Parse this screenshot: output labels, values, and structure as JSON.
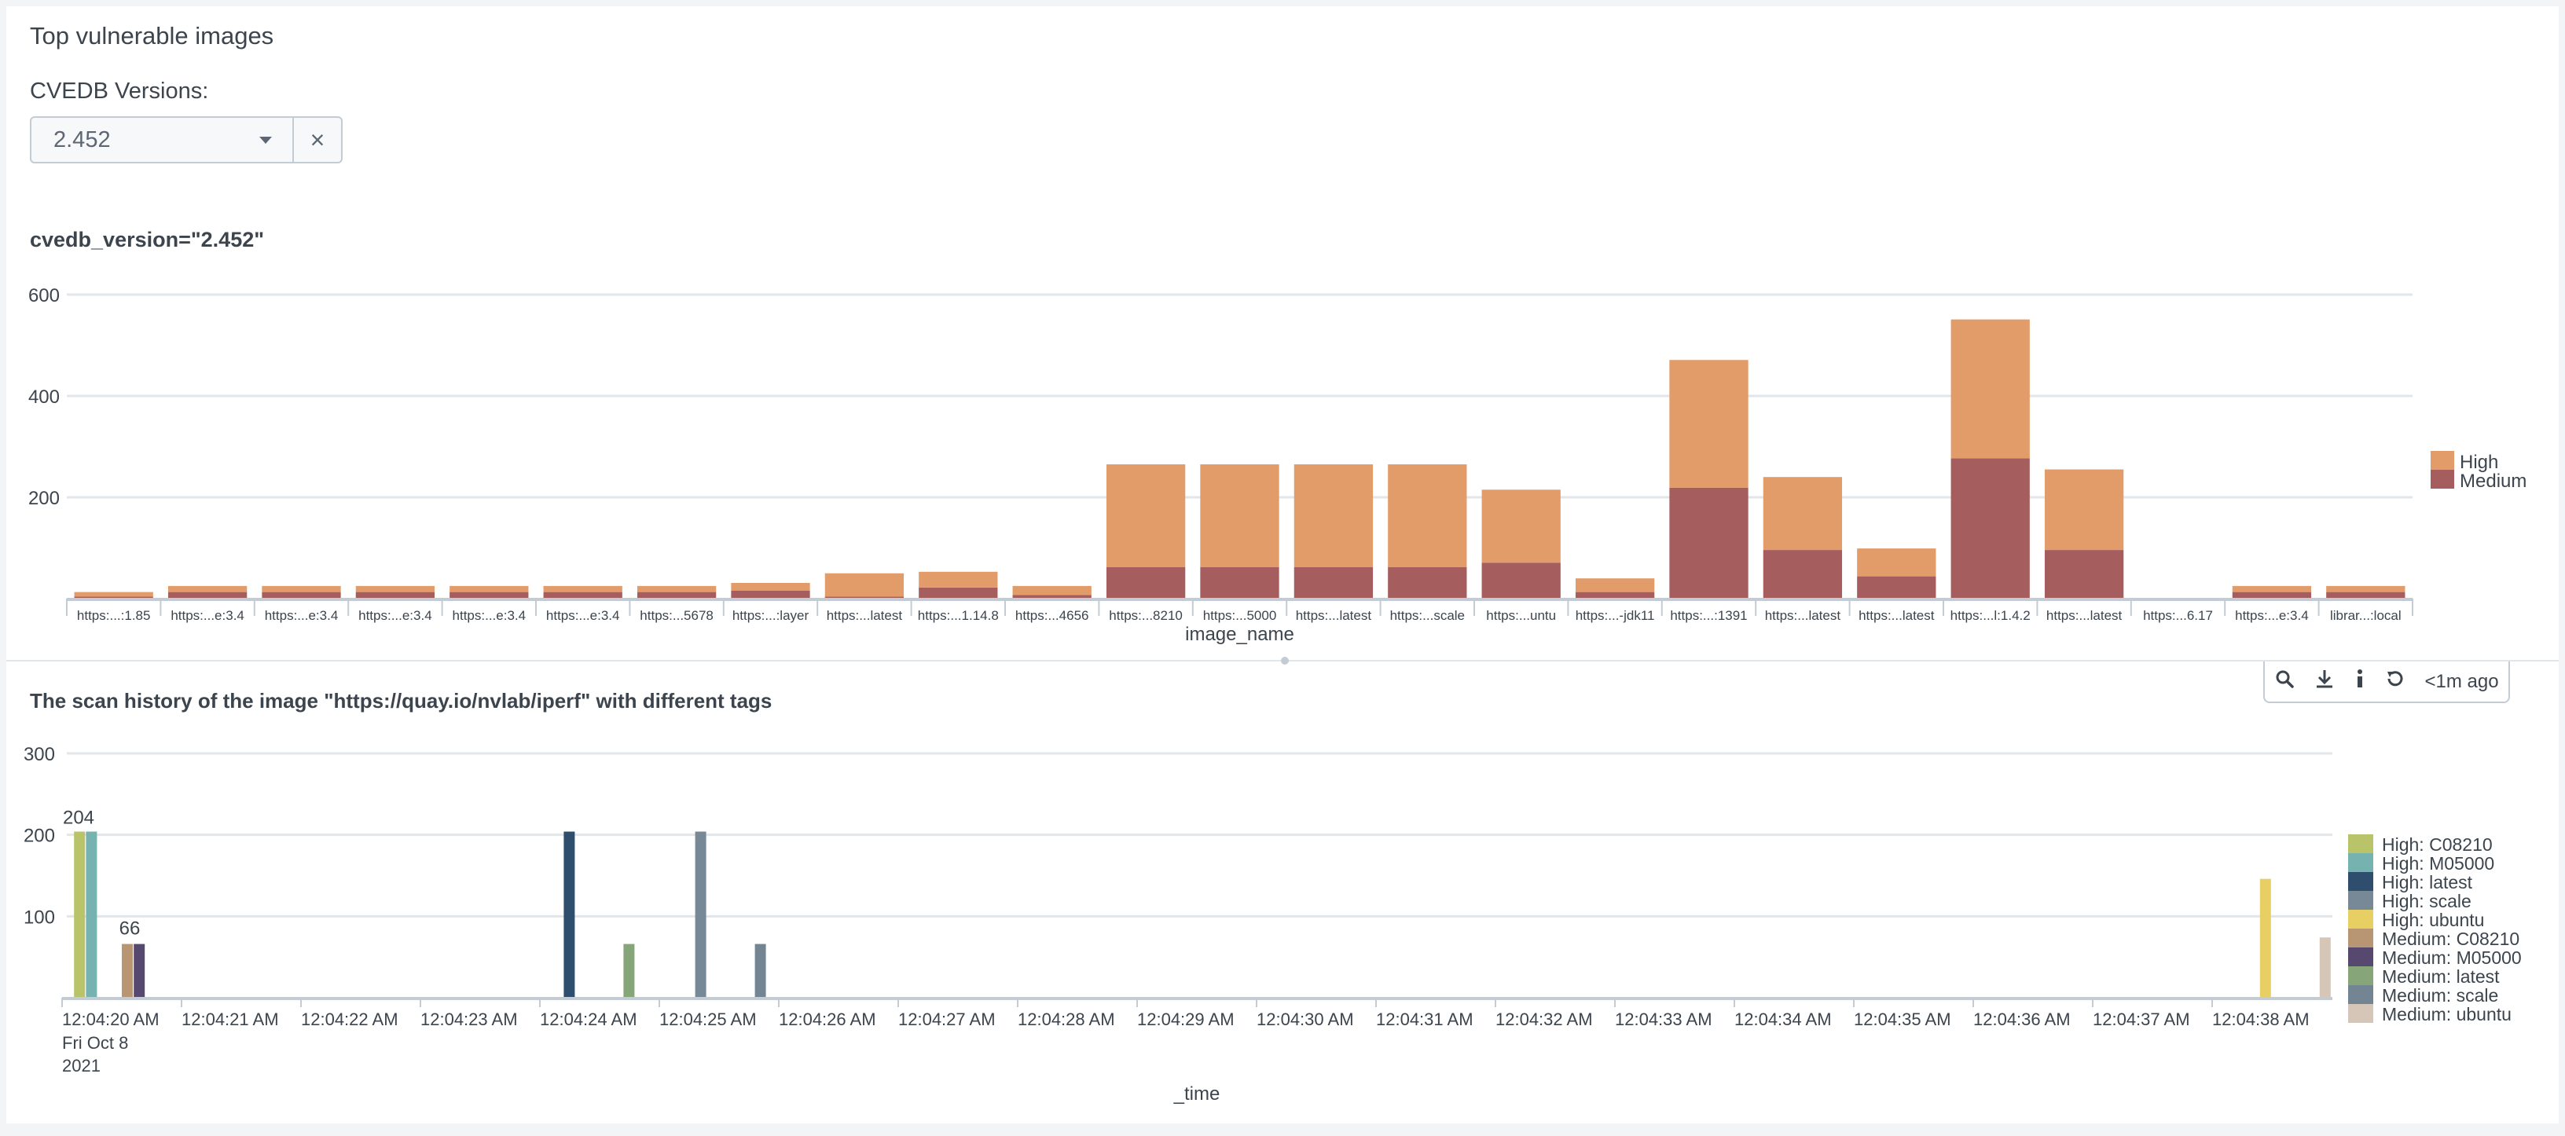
{
  "panel": {
    "title": "Top vulnerable images",
    "filter_label": "CVEDB Versions:",
    "filter_value": "2.452",
    "clear_icon": "×"
  },
  "chart1_title": "cvedb_version=\"2.452\"",
  "chart2_title": "The scan history of the image \"https://quay.io/nvlab/iperf\" with different tags",
  "toolbar": {
    "search_icon": "search-icon",
    "download_icon": "download-icon",
    "info_icon": "info-icon",
    "refresh_icon": "refresh-icon",
    "updated": "<1m ago"
  },
  "chart_data": [
    {
      "type": "bar",
      "stacked": true,
      "title": "cvedb_version=\"2.452\"",
      "xlabel": "image_name",
      "ylabel": "",
      "ylim": [
        0,
        600
      ],
      "yticks": [
        200,
        400,
        600
      ],
      "grid": true,
      "legend": "right",
      "categories": [
        "https:...:1.85",
        "https:...e:3.4",
        "https:...e:3.4",
        "https:...e:3.4",
        "https:...e:3.4",
        "https:...e:3.4",
        "https:...5678",
        "https:...:layer",
        "https:...latest",
        "https:...1.14.8",
        "https:...4656",
        "https:...8210",
        "https:...5000",
        "https:...latest",
        "https:...scale",
        "https:...untu",
        "https:...-jdk11",
        "https:...:1391",
        "https:...latest",
        "https:...latest",
        "https:...l:1.4.2",
        "https:...latest",
        "https:...6.17",
        "https:...e:3.4",
        "librar...:local"
      ],
      "series": [
        {
          "name": "Medium",
          "color": "#a55d5e",
          "values": [
            4,
            13,
            13,
            13,
            13,
            13,
            13,
            16,
            4,
            22,
            7,
            62,
            62,
            62,
            62,
            71,
            13,
            219,
            96,
            44,
            277,
            96,
            0,
            13,
            13
          ]
        },
        {
          "name": "High",
          "color": "#e19c69",
          "values": [
            9,
            12,
            12,
            12,
            12,
            12,
            12,
            15,
            46,
            31,
            18,
            203,
            203,
            203,
            203,
            144,
            27,
            252,
            144,
            55,
            274,
            159,
            0,
            12,
            12
          ]
        }
      ]
    },
    {
      "type": "bar",
      "title": "The scan history of the image \"https://quay.io/nvlab/iperf\" with different tags",
      "xlabel": "_time",
      "ylabel": "",
      "ylim": [
        0,
        300
      ],
      "yticks": [
        100,
        200,
        300
      ],
      "grid": true,
      "legend": "right",
      "x_ticks": [
        "12:04:20 AM",
        "12:04:21 AM",
        "12:04:22 AM",
        "12:04:23 AM",
        "12:04:24 AM",
        "12:04:25 AM",
        "12:04:26 AM",
        "12:04:27 AM",
        "12:04:28 AM",
        "12:04:29 AM",
        "12:04:30 AM",
        "12:04:31 AM",
        "12:04:32 AM",
        "12:04:33 AM",
        "12:04:34 AM",
        "12:04:35 AM",
        "12:04:36 AM",
        "12:04:37 AM",
        "12:04:38 AM"
      ],
      "x_date_line1": "Fri Oct 8",
      "x_date_line2": "2021",
      "data_labels": [
        "204",
        "66"
      ],
      "series": [
        {
          "name": "High: C08210",
          "color": "#b9c46a",
          "points": [
            {
              "time": "12:04:20.1",
              "value": 204
            }
          ]
        },
        {
          "name": "High: M05000",
          "color": "#76b3b0",
          "points": [
            {
              "time": "12:04:20.2",
              "value": 204
            }
          ]
        },
        {
          "name": "High: latest",
          "color": "#2f4d6c",
          "points": [
            {
              "time": "12:04:24.2",
              "value": 204
            }
          ]
        },
        {
          "name": "High: scale",
          "color": "#778896",
          "points": [
            {
              "time": "12:04:25.3",
              "value": 204
            }
          ]
        },
        {
          "name": "High: ubuntu",
          "color": "#e8cf63",
          "points": [
            {
              "time": "12:04:38.4",
              "value": 146
            }
          ]
        },
        {
          "name": "Medium: C08210",
          "color": "#b89673",
          "points": [
            {
              "time": "12:04:20.5",
              "value": 66
            }
          ]
        },
        {
          "name": "Medium: M05000",
          "color": "#57486f",
          "points": [
            {
              "time": "12:04:20.6",
              "value": 66
            }
          ]
        },
        {
          "name": "Medium: latest",
          "color": "#86a67a",
          "points": [
            {
              "time": "12:04:24.7",
              "value": 66
            }
          ]
        },
        {
          "name": "Medium: scale",
          "color": "#738592",
          "points": [
            {
              "time": "12:04:25.8",
              "value": 66
            }
          ]
        },
        {
          "name": "Medium: ubuntu",
          "color": "#d5c6b8",
          "points": [
            {
              "time": "12:04:38.9",
              "value": 74
            }
          ]
        }
      ]
    }
  ]
}
